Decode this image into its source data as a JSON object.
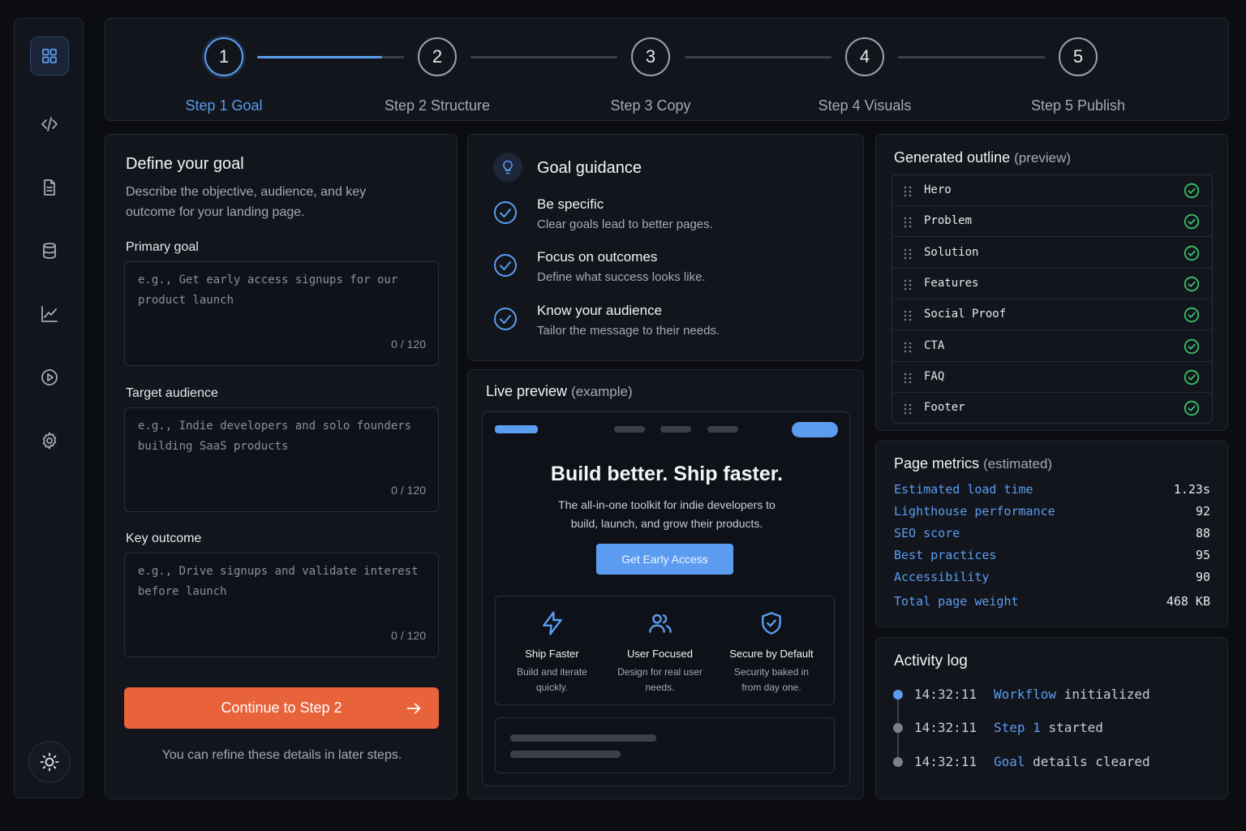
{
  "sidebar": {
    "items": [
      {
        "icon": "grid-icon",
        "active": true
      },
      {
        "icon": "code-icon",
        "active": false
      },
      {
        "icon": "document-icon",
        "active": false
      },
      {
        "icon": "database-icon",
        "active": false
      },
      {
        "icon": "chart-icon",
        "active": false
      },
      {
        "icon": "play-icon",
        "active": false
      },
      {
        "icon": "gear-icon",
        "active": false
      }
    ],
    "theme_icon": "sun-icon"
  },
  "stepper": {
    "steps": [
      {
        "number": "1",
        "label": "Step 1 Goal",
        "active": true
      },
      {
        "number": "2",
        "label": "Step 2 Structure",
        "active": false
      },
      {
        "number": "3",
        "label": "Step 3 Copy",
        "active": false
      },
      {
        "number": "4",
        "label": "Step 4 Visuals",
        "active": false
      },
      {
        "number": "5",
        "label": "Step 5 Publish",
        "active": false
      }
    ],
    "progress_first_segment": 0.85
  },
  "goal_form": {
    "title": "Define your goal",
    "description": "Describe the objective, audience, and key outcome for your landing page.",
    "fields": [
      {
        "label": "Primary goal",
        "placeholder": "e.g., Get early access signups for our product launch",
        "value": "",
        "counter": "0 / 120"
      },
      {
        "label": "Target audience",
        "placeholder": "e.g., Indie developers and solo founders building SaaS products",
        "value": "",
        "counter": "0 / 120"
      },
      {
        "label": "Key outcome",
        "placeholder": "e.g., Drive signups and validate interest before launch",
        "value": "",
        "counter": "0 / 120"
      }
    ],
    "continue_label": "Continue to Step 2",
    "hint": "You can refine these details in later steps."
  },
  "guidance": {
    "title": "Goal guidance",
    "items": [
      {
        "title": "Be specific",
        "desc": "Clear goals lead to better pages."
      },
      {
        "title": "Focus on outcomes",
        "desc": "Define what success looks like."
      },
      {
        "title": "Know your audience",
        "desc": "Tailor the message to their needs."
      }
    ]
  },
  "preview": {
    "title": "Live preview",
    "title_suffix": "(example)",
    "headline": "Build better. Ship faster.",
    "subheadline": "The all-in-one toolkit for indie developers to build, launch, and grow their products.",
    "button": "Get Early Access",
    "features": [
      {
        "icon": "lightning-icon",
        "title": "Ship Faster",
        "desc": "Build and iterate quickly."
      },
      {
        "icon": "users-icon",
        "title": "User Focused",
        "desc": "Design for real user needs."
      },
      {
        "icon": "shield-check-icon",
        "title": "Secure by Default",
        "desc": "Security baked in from day one."
      }
    ],
    "accent": "#5b9cf0"
  },
  "outline": {
    "title": "Generated outline",
    "title_suffix": "(preview)",
    "sections": [
      "Hero",
      "Problem",
      "Solution",
      "Features",
      "Social Proof",
      "CTA",
      "FAQ",
      "Footer"
    ]
  },
  "metrics": {
    "title": "Page metrics",
    "title_suffix": "(estimated)",
    "rows": [
      {
        "label": "Estimated load time",
        "value": "1.23s"
      },
      {
        "label": "Lighthouse performance",
        "value": "92"
      },
      {
        "label": "SEO score",
        "value": "88"
      },
      {
        "label": "Best practices",
        "value": "95"
      },
      {
        "label": "Accessibility",
        "value": "90"
      },
      {
        "label": "Total page weight",
        "value": "468 KB"
      }
    ]
  },
  "activity": {
    "title": "Activity log",
    "entries": [
      {
        "time": "14:32:11",
        "keyword": "Workflow",
        "text": "initialized",
        "active": true
      },
      {
        "time": "14:32:11",
        "keyword": "Step 1",
        "text": "started",
        "active": false
      },
      {
        "time": "14:32:11",
        "keyword": "Goal",
        "text": "details cleared",
        "active": false
      }
    ]
  },
  "colors": {
    "accent": "#5b9cf0",
    "cta": "#e8623a",
    "success": "#3cc06a",
    "background": "#0b0d12"
  }
}
